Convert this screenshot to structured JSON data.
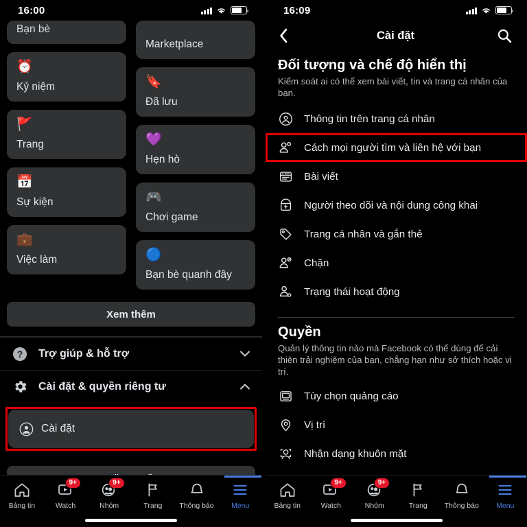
{
  "left": {
    "status": {
      "time": "16:00"
    },
    "menu_tiles_left": [
      {
        "label": "Bạn bè",
        "icon": "friends-icon",
        "clipped": true
      },
      {
        "label": "Kỷ niệm",
        "icon": "memories-clock-icon",
        "clipped": false
      },
      {
        "label": "Trang",
        "icon": "pages-flag-icon",
        "clipped": false
      },
      {
        "label": "Sự kiện",
        "icon": "events-calendar-icon",
        "clipped": false
      },
      {
        "label": "Việc làm",
        "icon": "jobs-briefcase-icon",
        "clipped": false
      }
    ],
    "menu_tiles_right": [
      {
        "label": "Marketplace",
        "icon": "marketplace-storefront-icon",
        "clipped": true
      },
      {
        "label": "Đã lưu",
        "icon": "saved-bookmark-icon",
        "clipped": false
      },
      {
        "label": "Hẹn hò",
        "icon": "dating-heart-icon",
        "clipped": false
      },
      {
        "label": "Chơi game",
        "icon": "gaming-controller-icon",
        "clipped": false
      },
      {
        "label": "Bạn bè quanh đây",
        "icon": "nearby-friends-icon",
        "clipped": false
      }
    ],
    "see_more_label": "Xem thêm",
    "help_row": {
      "label": "Trợ giúp & hỗ trợ",
      "icon": "help-question-icon",
      "chevron": "chevron-down-icon"
    },
    "settings_row": {
      "label": "Cài đặt & quyền riêng tư",
      "icon": "gear-icon",
      "chevron": "chevron-up-icon"
    },
    "settings_sub": {
      "label": "Cài đặt",
      "icon": "account-circle-icon",
      "highlight_color": "#e00000"
    },
    "logout_label": "Đăng xuất"
  },
  "right": {
    "status": {
      "time": "16:09"
    },
    "navbar": {
      "back": "‹",
      "title": "Cài đặt",
      "search_icon": "search-icon"
    },
    "section_audience": {
      "title": "Đối tượng và chế độ hiển thị",
      "desc": "Kiểm soát ai có thể xem bài viết, tin và trang cá nhân của bạn.",
      "items": [
        {
          "label": "Thông tin trên trang cá nhân",
          "icon": "profile-circle-icon",
          "highlighted": false
        },
        {
          "label": "Cách mọi người tìm và liên hệ với bạn",
          "icon": "people-find-icon",
          "highlighted": true
        },
        {
          "label": "Bài viết",
          "icon": "posts-card-icon",
          "highlighted": false
        },
        {
          "label": "Người theo dõi và nội dung công khai",
          "icon": "followers-plus-icon",
          "highlighted": false
        },
        {
          "label": "Trang cá nhân và gắn thẻ",
          "icon": "tag-icon",
          "highlighted": false
        },
        {
          "label": "Chặn",
          "icon": "block-person-icon",
          "highlighted": false
        },
        {
          "label": "Trạng thái hoạt động",
          "icon": "active-status-icon",
          "highlighted": false
        }
      ]
    },
    "section_permissions": {
      "title": "Quyền",
      "desc": "Quản lý thông tin nào mà Facebook có thể dùng để cải thiện trải nghiệm của bạn, chẳng hạn như sở thích hoặc vị trí.",
      "items": [
        {
          "label": "Tùy chọn quảng cáo",
          "icon": "ads-monitor-icon"
        },
        {
          "label": "Vị trí",
          "icon": "location-pin-icon"
        },
        {
          "label": "Nhận dạng khuôn mặt",
          "icon": "face-recognition-icon"
        }
      ]
    }
  },
  "tabbar": {
    "items": [
      {
        "label": "Bảng tin",
        "icon": "home-icon",
        "badge": "",
        "active": false
      },
      {
        "label": "Watch",
        "icon": "watch-video-icon",
        "badge": "9+",
        "active": false
      },
      {
        "label": "Nhóm",
        "icon": "groups-icon",
        "badge": "9+",
        "active": false
      },
      {
        "label": "Trang",
        "icon": "pages-flag-icon",
        "badge": "",
        "active": false
      },
      {
        "label": "Thông báo",
        "icon": "bell-icon",
        "badge": "",
        "active": false
      },
      {
        "label": "Menu",
        "icon": "hamburger-menu-icon",
        "badge": "",
        "active": true
      }
    ],
    "accent_color": "#4a7fe0",
    "badge_color": "#e4172b"
  }
}
